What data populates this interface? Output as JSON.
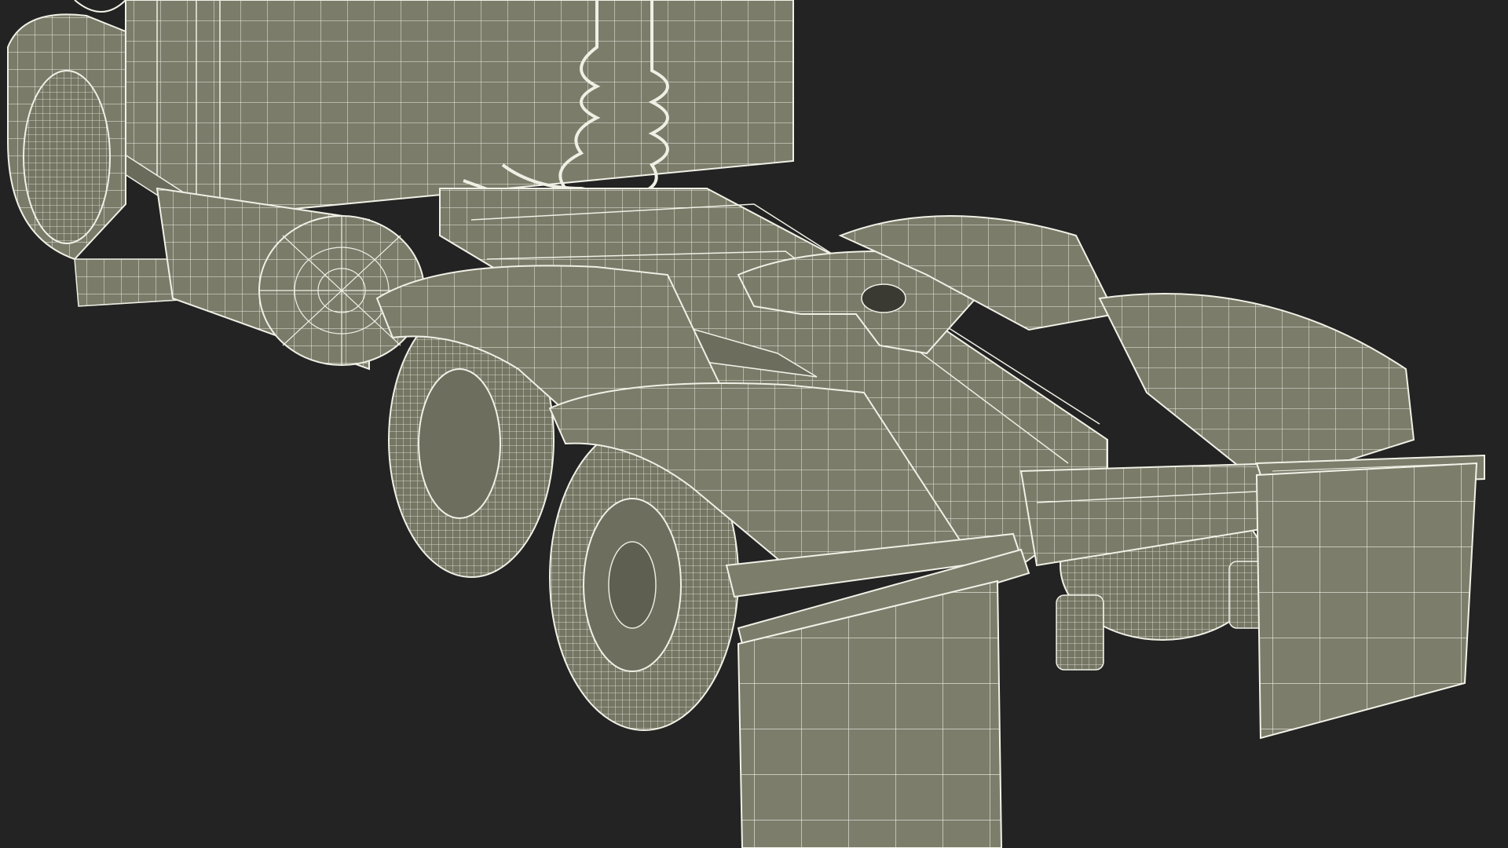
{
  "scene": {
    "subject": "semi-truck-tractor-rear-wireframe",
    "colors": {
      "background": "#232323",
      "surface": "#7a7a69",
      "surface_dark": "#5f5f51",
      "surface_shadow": "#4a4a40",
      "wire": "#f2f2e8",
      "wire_dim": "#d6d6c8"
    }
  }
}
